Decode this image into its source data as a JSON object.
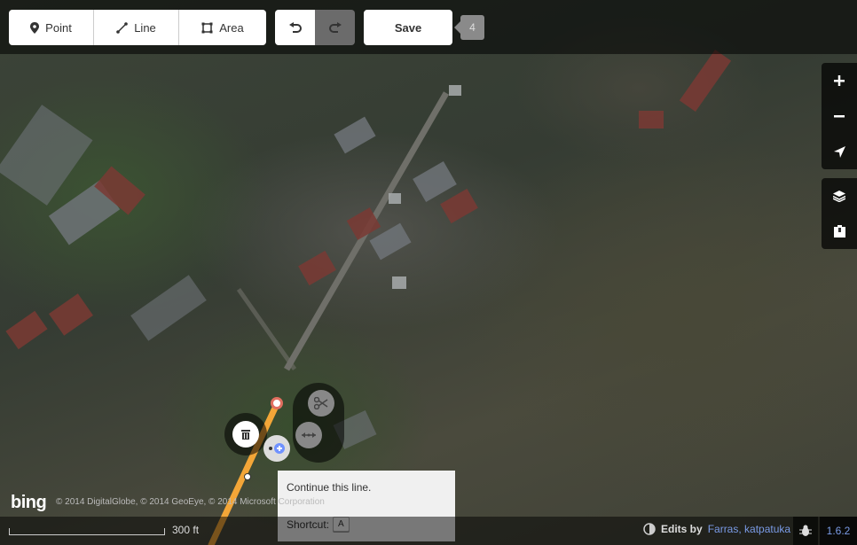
{
  "toolbar": {
    "point_label": "Point",
    "line_label": "Line",
    "area_label": "Area",
    "undo_icon": "undo-icon",
    "redo_icon": "redo-icon",
    "save_label": "Save",
    "edit_count": "4"
  },
  "map_controls": {
    "zoom_in": "zoom-in-icon",
    "zoom_out": "zoom-out-icon",
    "geolocate": "geolocate-icon",
    "background": "layers-icon",
    "map_data": "map-data-icon"
  },
  "operations": [
    "delete-icon",
    "continue-icon",
    "split-icon",
    "move-icon"
  ],
  "tooltip": {
    "text": "Continue this line.",
    "shortcut_label": "Shortcut:",
    "shortcut_key": "A"
  },
  "footer": {
    "bing_logo": "bing",
    "attribution": "© 2014 DigitalGlobe, © 2014 GeoEye, © 2014 Microsoft Corporation",
    "scale": "300 ft",
    "edits_by": "Edits by",
    "editors": "Farras, katpatuka",
    "version": "1.6.2"
  },
  "colors": {
    "selected_way": "#f3a638",
    "vertex_end": "#e06e5f",
    "continue_accent": "#7092ff"
  }
}
